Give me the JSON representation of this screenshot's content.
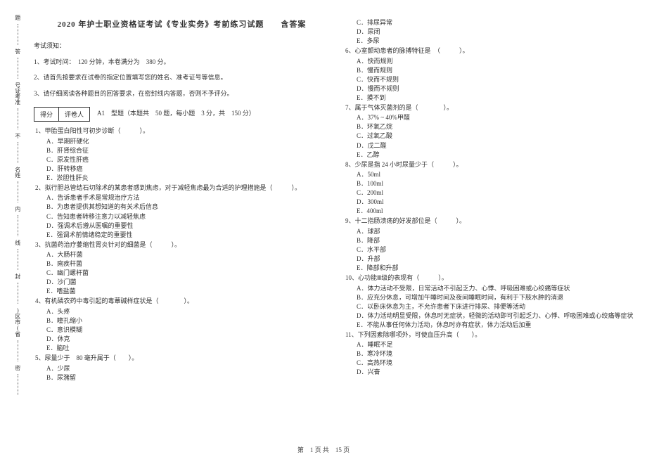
{
  "margin_labels": [
    "题",
    "答",
    "号证考准",
    "不",
    "名姓",
    "内",
    "线",
    "封",
    ")区市(省",
    "密"
  ],
  "title": "2020 年护士职业资格证考试《专业实务》考前练习试题　　含答案",
  "notice_head": "考试须知：",
  "instructions": [
    "1、考试时间：　120 分钟，本卷满分为　380 分。",
    "2、请首先按要求在试卷的指定位置填写您的姓名、准考证号等信息。",
    "3、请仔细阅读各种题目的回答要求，在密封线内答题，否则不予评分。"
  ],
  "score_labels": [
    "得分",
    "评卷人"
  ],
  "type_title": "A1　型题（本题共　50 题，每小题　3 分，共　150 分）",
  "questions_col1": [
    {
      "n": "1、",
      "t": "甲胎蛋白阳性可初步诊断（　　　）。",
      "opts": [
        "A．早期肝硬化",
        "B．肝肾综合征",
        "C．原发性肝癌",
        "D．肝转移癌",
        "E．淤胆性肝炎"
      ]
    },
    {
      "n": "2、",
      "t": "拟行胆总管结石切除术的某患者感到焦虑，对于减轻焦虑最为合适的护理措施是（　　　）。",
      "opts": [
        "A．告诉患者手术是常规治疗方法",
        "B．为患者提供其想知道的有关术后信息",
        "C．告知患者转移注意力以减轻焦虑",
        "D．强调术后遵从医嘱的重要性",
        "E．强调术前情绪稳定的重要性"
      ]
    },
    {
      "n": "3、",
      "t": "抗菌药治疗萎缩性胃炎针对的细菌是（　　　）。",
      "opts": [
        "A．大肠杆菌",
        "B．痢疾杆菌",
        "C．幽门螺杆菌",
        "D．沙门菌",
        "E．嗜盐菌"
      ]
    },
    {
      "n": "4、",
      "t": "有机磷农药中毒引起的毒蕈碱样症状是（　　　　）。",
      "opts": [
        "A．头疼",
        "B．瞳孔缩小",
        "C．意识模糊",
        "D．休克",
        "E．脑吐"
      ]
    },
    {
      "n": "5、",
      "t": "尿量少于　80 毫升属于（　　）。",
      "opts": [
        "A．少尿",
        "B．尿潴留"
      ]
    }
  ],
  "questions_col2_pre": [
    "C．排尿异常",
    "D．尿闭",
    "E．多尿"
  ],
  "questions_col2": [
    {
      "n": "6、",
      "t": "心室颤动患者的脉搏特征是　（　　　）。",
      "opts": [
        "A．快而规则",
        "B．慢而规则",
        "C．快而不规则",
        "D．慢而不规则",
        "E．摸不到"
      ]
    },
    {
      "n": "7、",
      "t": "属于气体灭菌剂的是（　　　　）。",
      "opts": [
        "A．37% ~ 40%甲醛",
        "B．环氧乙烷",
        "C．过氧乙酸",
        "D．戊二醛",
        "E．乙醇"
      ]
    },
    {
      "n": "8、",
      "t": "少尿是指 24 小时尿量少于（　　　）。",
      "opts": [
        "A．50ml",
        "B．100ml",
        "C．200ml",
        "D．300ml",
        "E．400ml"
      ]
    },
    {
      "n": "9、",
      "t": "十二指肠溃疡的好发部位是（　　　）。",
      "opts": [
        "A．球部",
        "B．降部",
        "C．水平部",
        "D．升部",
        "E．降部和升部"
      ]
    },
    {
      "n": "10、",
      "t": "心功能Ⅲ级的表现有（　　　）。",
      "opts": [
        "A．体力活动不受限，日常活动不引起乏力、心悸、呼吸困难或心绞痛等症状",
        "B．应充分休息，可增加午睡时间及夜间睡眠时间，有利于下肢水肿的消退",
        "C．以卧床休息为主，不允许患者下床进行排尿、排便等活动",
        "D．体力活动明显受限，休息时无症状，轻微的活动即可引起乏力、心悸、呼吸困难或心绞痛等症状",
        "E．不能从事任何体力活动，休息时亦有症状，体力活动后加重"
      ]
    },
    {
      "n": "11、",
      "t": "下列因素除哪项外，可使血压升高（　　）。",
      "opts": [
        "A．睡眠不足",
        "B．寒冷环境",
        "C．高热环境",
        "D．兴奋"
      ]
    }
  ],
  "footer": "第　1 页 共　15 页"
}
